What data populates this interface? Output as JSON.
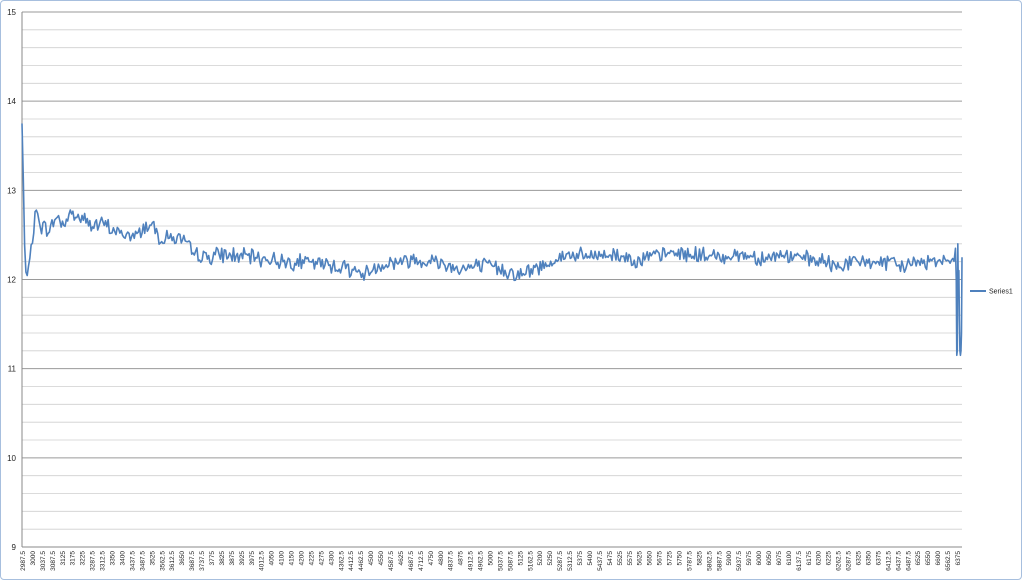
{
  "chart_data": {
    "type": "line",
    "title": "",
    "xlabel": "",
    "ylabel": "",
    "ylim": [
      9,
      15
    ],
    "ymajor_ticks": [
      9,
      10,
      11,
      12,
      13,
      14,
      15
    ],
    "yminor_step": 0.2,
    "grid": true,
    "legend": "right",
    "x_range": [
      2987.5,
      6375
    ],
    "x_step": 5,
    "xtick_labels": [
      "2987.5",
      "3000",
      "3037.5",
      "3087.5",
      "3125",
      "3175",
      "3225",
      "3287.5",
      "3312.5",
      "3350",
      "3400",
      "3437.5",
      "3487.5",
      "3525",
      "3562.5",
      "3612.5",
      "3650",
      "3687.5",
      "3737.5",
      "3775",
      "3825",
      "3875",
      "3925",
      "3975",
      "4012.5",
      "4050",
      "4100",
      "4150",
      "4200",
      "4225",
      "4275",
      "4300",
      "4362.5",
      "4412.5",
      "4462.5",
      "4500",
      "4550",
      "4587.5",
      "4625",
      "4687.5",
      "4712.5",
      "4750",
      "4800",
      "4837.5",
      "4875",
      "4912.5",
      "4962.5",
      "5000",
      "5037.5",
      "5087.5",
      "5125",
      "5162.5",
      "5200",
      "5250",
      "5287.5",
      "5312.5",
      "5375",
      "5400",
      "5437.5",
      "5475",
      "5525",
      "5575",
      "5625",
      "5650",
      "5675",
      "5725",
      "5750",
      "5787.5",
      "5825",
      "5862.5",
      "5887.5",
      "5900",
      "5937.5",
      "5975",
      "6000",
      "6050",
      "6075",
      "6100",
      "6137.5",
      "6175",
      "6200",
      "6225",
      "6262.5",
      "6287.5",
      "6325",
      "6350",
      "6375",
      "6412.5",
      "6437.5",
      "6487.5",
      "6525",
      "6550",
      "6600",
      "6562.5",
      "6375"
    ],
    "series": [
      {
        "name": "Series1",
        "color": "#4f81bd",
        "anchors": [
          [
            2987.5,
            13.75
          ],
          [
            2992,
            13.2
          ],
          [
            2998,
            12.3
          ],
          [
            3005,
            11.95
          ],
          [
            3012,
            12.15
          ],
          [
            3025,
            12.4
          ],
          [
            3042,
            12.78
          ],
          [
            3060,
            12.6
          ],
          [
            3090,
            12.55
          ],
          [
            3120,
            12.7
          ],
          [
            3150,
            12.62
          ],
          [
            3175,
            12.75
          ],
          [
            3200,
            12.7
          ],
          [
            3225,
            12.68
          ],
          [
            3262,
            12.6
          ],
          [
            3300,
            12.62
          ],
          [
            3340,
            12.55
          ],
          [
            3380,
            12.5
          ],
          [
            3420,
            12.48
          ],
          [
            3460,
            12.6
          ],
          [
            3490,
            12.62
          ],
          [
            3520,
            12.45
          ],
          [
            3560,
            12.48
          ],
          [
            3600,
            12.45
          ],
          [
            3640,
            12.3
          ],
          [
            3690,
            12.25
          ],
          [
            3750,
            12.28
          ],
          [
            3800,
            12.27
          ],
          [
            3850,
            12.25
          ],
          [
            3900,
            12.24
          ],
          [
            3950,
            12.22
          ],
          [
            4000,
            12.2
          ],
          [
            4050,
            12.2
          ],
          [
            4100,
            12.18
          ],
          [
            4150,
            12.17
          ],
          [
            4200,
            12.15
          ],
          [
            4250,
            12.12
          ],
          [
            4290,
            12.05
          ],
          [
            4330,
            12.12
          ],
          [
            4380,
            12.18
          ],
          [
            4430,
            12.2
          ],
          [
            4480,
            12.22
          ],
          [
            4530,
            12.22
          ],
          [
            4580,
            12.2
          ],
          [
            4630,
            12.15
          ],
          [
            4680,
            12.12
          ],
          [
            4730,
            12.15
          ],
          [
            4780,
            12.15
          ],
          [
            4820,
            12.12
          ],
          [
            4860,
            12.08
          ],
          [
            4900,
            12.05
          ],
          [
            4940,
            12.1
          ],
          [
            4980,
            12.15
          ],
          [
            5020,
            12.22
          ],
          [
            5060,
            12.25
          ],
          [
            5100,
            12.28
          ],
          [
            5150,
            12.25
          ],
          [
            5200,
            12.27
          ],
          [
            5250,
            12.28
          ],
          [
            5300,
            12.25
          ],
          [
            5350,
            12.22
          ],
          [
            5400,
            12.25
          ],
          [
            5450,
            12.28
          ],
          [
            5500,
            12.3
          ],
          [
            5550,
            12.28
          ],
          [
            5600,
            12.27
          ],
          [
            5650,
            12.25
          ],
          [
            5700,
            12.27
          ],
          [
            5750,
            12.28
          ],
          [
            5800,
            12.25
          ],
          [
            5850,
            12.25
          ],
          [
            5900,
            12.27
          ],
          [
            5950,
            12.25
          ],
          [
            6000,
            12.22
          ],
          [
            6050,
            12.2
          ],
          [
            6100,
            12.15
          ],
          [
            6150,
            12.18
          ],
          [
            6200,
            12.2
          ],
          [
            6250,
            12.2
          ],
          [
            6300,
            12.18
          ],
          [
            6350,
            12.15
          ],
          [
            6400,
            12.18
          ],
          [
            6450,
            12.2
          ],
          [
            6500,
            12.22
          ],
          [
            6540,
            12.25
          ],
          [
            6560,
            12.15
          ]
        ],
        "tail": [
          [
            6563,
            12.35
          ],
          [
            6566,
            12.0
          ],
          [
            6568,
            11.15
          ],
          [
            6570,
            11.2
          ],
          [
            6572,
            12.4
          ],
          [
            6574,
            11.9
          ],
          [
            6576,
            12.1
          ],
          [
            6578,
            11.55
          ],
          [
            6580,
            11.2
          ],
          [
            6582,
            11.15
          ],
          [
            6584,
            11.2
          ],
          [
            6586,
            11.4
          ],
          [
            6588,
            12.25
          ]
        ],
        "noise_amplitude": 0.07
      }
    ]
  }
}
